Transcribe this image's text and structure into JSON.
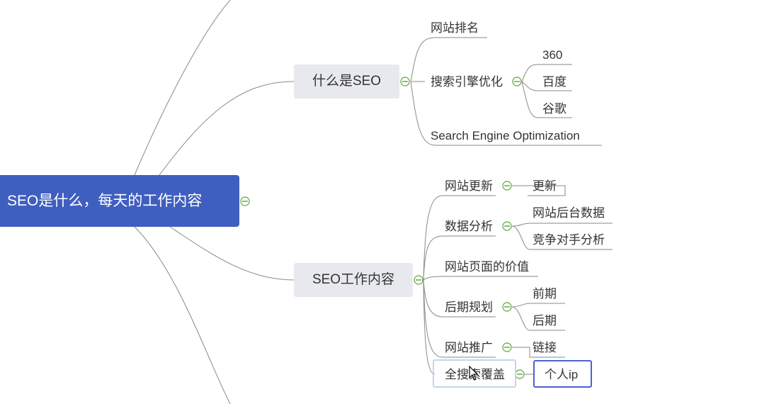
{
  "root": {
    "label": "SEO是什么，每天的工作内容"
  },
  "branch_what": {
    "label": "什么是SEO",
    "children": {
      "ranking": "网站排名",
      "search_engine_opt": "搜索引擎优化",
      "engines": [
        "360",
        "百度",
        "谷歌"
      ],
      "english": "Search  Engine Optimization"
    }
  },
  "branch_work": {
    "label": "SEO工作内容",
    "children": {
      "update": "网站更新",
      "update_child": "更新",
      "analysis": "数据分析",
      "analysis_children": [
        "网站后台数据",
        "竞争对手分析"
      ],
      "page_value": "网站页面的价值",
      "planning": "后期规划",
      "planning_children": [
        "前期",
        "后期"
      ],
      "promotion": "网站推广",
      "promotion_child": "链接",
      "full_search": "全搜索覆盖",
      "full_search_child": "个人ip"
    }
  },
  "colors": {
    "root_bg": "#3f5fc0",
    "collapse_icon": "#5aa53a",
    "selection": "#4b62d2"
  }
}
